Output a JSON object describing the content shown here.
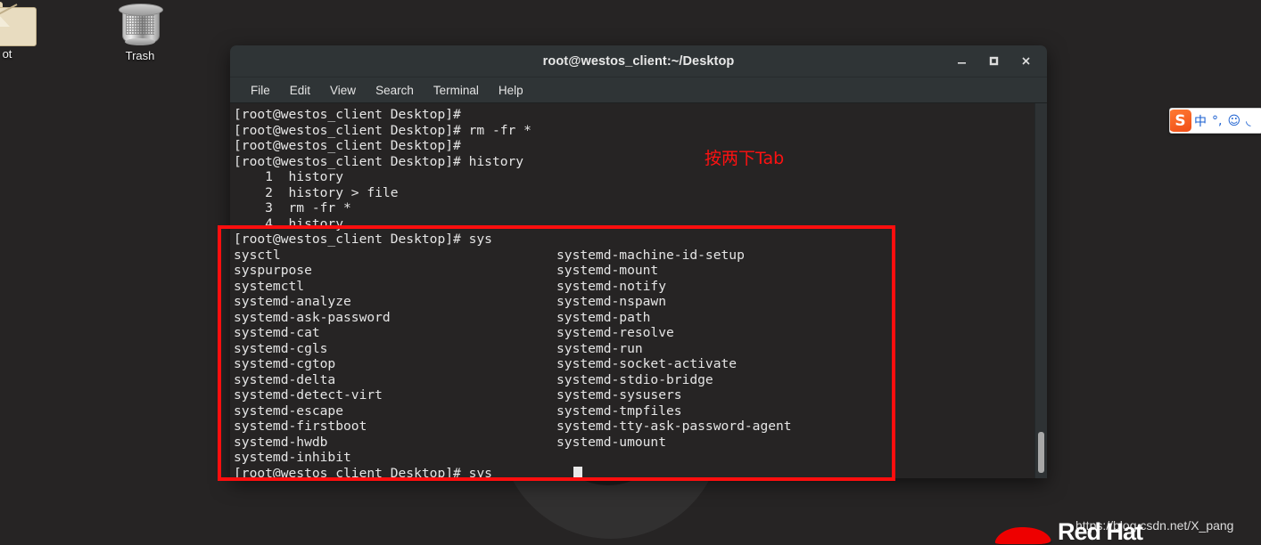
{
  "desktop": {
    "icons": [
      {
        "name": "root-folder",
        "label": "ot",
        "icon": "folder-icon"
      },
      {
        "name": "trash",
        "label": "Trash",
        "icon": "trash-icon"
      }
    ]
  },
  "terminal": {
    "title": "root@westos_client:~/Desktop",
    "window_buttons": {
      "minimize": "minimize-icon",
      "maximize": "maximize-icon",
      "close": "close-icon"
    },
    "menu": [
      "File",
      "Edit",
      "View",
      "Search",
      "Terminal",
      "Help"
    ],
    "lines_top": [
      "[root@westos_client Desktop]#",
      "[root@westos_client Desktop]# rm -fr *",
      "[root@westos_client Desktop]#",
      "[root@westos_client Desktop]# history",
      "    1  history",
      "    2  history > file",
      "    3  rm -fr *",
      "    4  history"
    ],
    "prompt_sys": "[root@westos_client Desktop]# sys",
    "completions_left": [
      "sysctl",
      "syspurpose",
      "systemctl",
      "systemd-analyze",
      "systemd-ask-password",
      "systemd-cat",
      "systemd-cgls",
      "systemd-cgtop",
      "systemd-delta",
      "systemd-detect-virt",
      "systemd-escape",
      "systemd-firstboot",
      "systemd-hwdb",
      "systemd-inhibit"
    ],
    "completions_right": [
      "systemd-machine-id-setup",
      "systemd-mount",
      "systemd-notify",
      "systemd-nspawn",
      "systemd-path",
      "systemd-resolve",
      "systemd-run",
      "systemd-socket-activate",
      "systemd-stdio-bridge",
      "systemd-sysusers",
      "systemd-tmpfiles",
      "systemd-tty-ask-password-agent",
      "systemd-umount"
    ],
    "final_prompt": "[root@westos_client Desktop]# sys",
    "cursor": "block-cursor"
  },
  "annotation": {
    "text": "按两下Tab",
    "color": "#ff1111",
    "box_color": "#fd0e0e"
  },
  "ime": {
    "logo": "sogou-logo",
    "buttons": [
      "中",
      "°,",
      "☺",
      "◟"
    ]
  },
  "watermark": {
    "brand": "Red Hat",
    "url": "https://blog.csdn.net/X_pang"
  }
}
